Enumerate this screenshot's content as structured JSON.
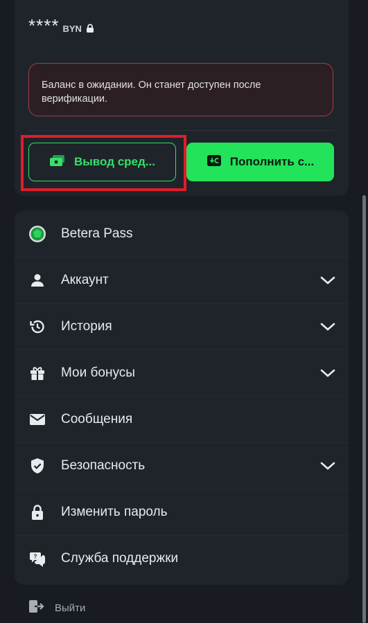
{
  "balance": {
    "masked_amount": "****",
    "currency": "BYN",
    "notice": "Баланс в ожидании. Он станет доступен после верификации."
  },
  "actions": {
    "withdraw_label": "Вывод сред...",
    "deposit_label": "Пополнить с..."
  },
  "menu": {
    "items": [
      {
        "label": "Betera Pass",
        "icon": "betera-pass-icon",
        "expandable": false
      },
      {
        "label": "Аккаунт",
        "icon": "user-icon",
        "expandable": true
      },
      {
        "label": "История",
        "icon": "history-icon",
        "expandable": true
      },
      {
        "label": "Мои бонусы",
        "icon": "gift-icon",
        "expandable": true
      },
      {
        "label": "Сообщения",
        "icon": "mail-icon",
        "expandable": false
      },
      {
        "label": "Безопасность",
        "icon": "shield-icon",
        "expandable": true
      },
      {
        "label": "Изменить пароль",
        "icon": "lock-icon",
        "expandable": false
      },
      {
        "label": "Служба поддержки",
        "icon": "support-chat-icon",
        "expandable": false
      }
    ]
  },
  "footer": {
    "logout_label": "Выйти"
  },
  "colors": {
    "accent": "#22e35a",
    "highlight": "#e11d28",
    "notice_border": "#a73b47"
  }
}
